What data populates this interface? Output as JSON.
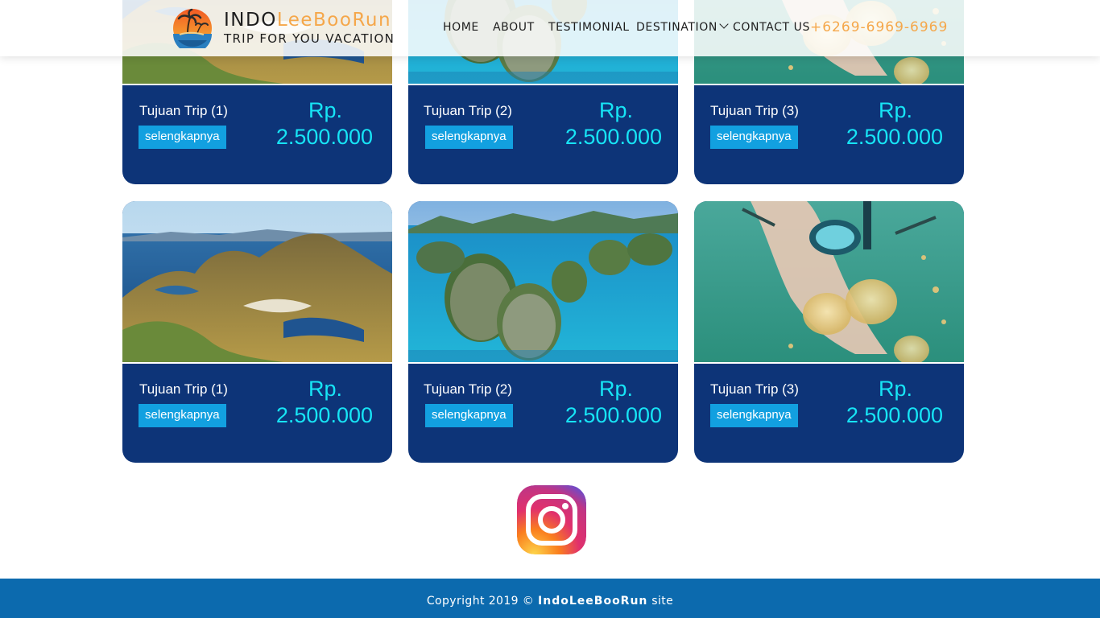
{
  "header": {
    "brand_part1": "INDO",
    "brand_part2": "LeeBooRun",
    "tagline": "TRIP FOR YOU VACATION",
    "nav": {
      "home": "HOME",
      "about": "ABOUT",
      "testimonial": "TESTIMONIAL",
      "destination": "DESTINATION",
      "contact": "CONTACT US"
    },
    "phone": "+6269-6969-6969"
  },
  "cards": [
    {
      "title": "Tujuan Trip (1)",
      "button": "selengkapnya",
      "price_label": "Rp.",
      "price": "2.500.000"
    },
    {
      "title": "Tujuan Trip (2)",
      "button": "selengkapnya",
      "price_label": "Rp.",
      "price": "2.500.000"
    },
    {
      "title": "Tujuan Trip (3)",
      "button": "selengkapnya",
      "price_label": "Rp.",
      "price": "2.500.000"
    },
    {
      "title": "Tujuan Trip (1)",
      "button": "selengkapnya",
      "price_label": "Rp.",
      "price": "2.500.000"
    },
    {
      "title": "Tujuan Trip (2)",
      "button": "selengkapnya",
      "price_label": "Rp.",
      "price": "2.500.000"
    },
    {
      "title": "Tujuan Trip (3)",
      "button": "selengkapnya",
      "price_label": "Rp.",
      "price": "2.500.000"
    }
  ],
  "footer": {
    "prefix": "Copyright 2019 ©",
    "brand": "IndoLeeBooRun",
    "suffix": "site"
  },
  "icons": {
    "instagram": "instagram-icon",
    "logo": "sunset-palm-logo-icon",
    "dropdown": "chevron-down-icon"
  },
  "colors": {
    "card_bg": "#0d3478",
    "button_bg": "#12a0e0",
    "price": "#17e4f5",
    "accent": "#f5a74a",
    "footer_bg": "#0c6aae"
  }
}
